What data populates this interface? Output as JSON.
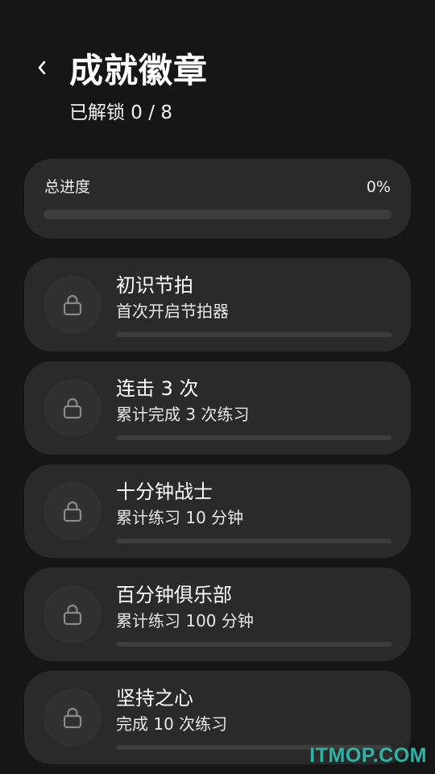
{
  "header": {
    "back_icon": "chevron-left-icon",
    "title": "成就徽章",
    "subtitle": "已解锁 0 / 8"
  },
  "overall": {
    "label": "总进度",
    "percent_text": "0%",
    "progress": 0
  },
  "achievements": [
    {
      "title": "初识节拍",
      "desc": "首次开启节拍器",
      "icon": "lock-icon",
      "progress": 0
    },
    {
      "title": "连击 3 次",
      "desc": "累计完成 3 次练习",
      "icon": "lock-icon",
      "progress": 0
    },
    {
      "title": "十分钟战士",
      "desc": "累计练习 10 分钟",
      "icon": "lock-icon",
      "progress": 0
    },
    {
      "title": "百分钟俱乐部",
      "desc": "累计练习 100 分钟",
      "icon": "lock-icon",
      "progress": 0
    },
    {
      "title": "坚持之心",
      "desc": "完成 10 次练习",
      "icon": "lock-icon",
      "progress": 0
    }
  ],
  "watermark": "ITMOP.COM",
  "colors": {
    "background": "#161616",
    "card": "#2a2a2a",
    "track": "#3d3d3d",
    "watermark": "#2fb3a6"
  }
}
